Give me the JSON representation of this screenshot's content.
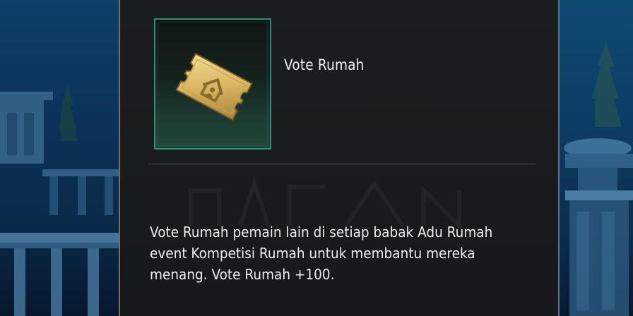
{
  "item": {
    "icon": "house-vote-ticket-icon",
    "title": "Vote Rumah"
  },
  "description": {
    "lines": [
      "Vote Rumah pemain lain di setiap babak Adu Rumah",
      "event Kompetisi Rumah untuk membantu mereka",
      "menang. Vote Rumah +100."
    ]
  },
  "colors": {
    "panel_bg": "#1a1b1c",
    "frame_border": "#2f8f77",
    "ticket_gold": "#d9b560",
    "text": "#f2f2f0",
    "scene_blue": "#0c3a60"
  }
}
